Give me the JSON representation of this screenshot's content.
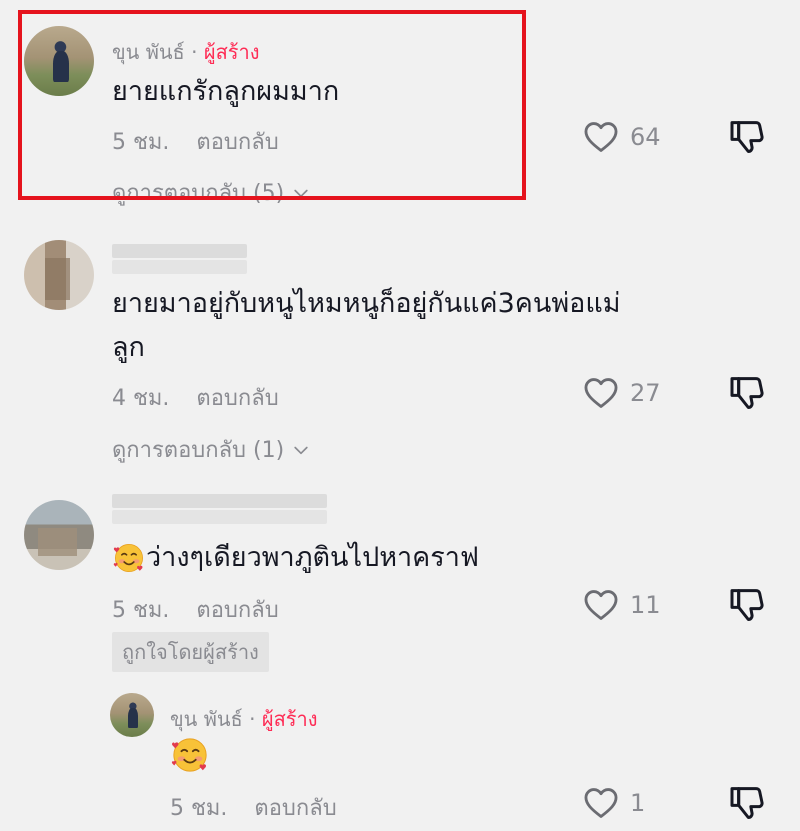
{
  "comments": [
    {
      "author": "ขุน พันธ์",
      "creator_label": "ผู้สร้าง",
      "text": "ยายแกรักลูกผมมาก",
      "time": "5 ชม.",
      "reply": "ตอบกลับ",
      "likes": "64",
      "view_replies": "ดูการตอบกลับ (5)"
    },
    {
      "author": "",
      "text_line1": "ยายมาอยู่กับหนูไหมหนูก็อยู่กันแค่3คนพ่อแม่",
      "text_line2": "ลูก",
      "time": "4 ชม.",
      "reply": "ตอบกลับ",
      "likes": "27",
      "view_replies": "ดูการตอบกลับ (1)"
    },
    {
      "author": "",
      "emoji": "smiling-face-with-hearts",
      "text": "ว่างๆเดียวพาภูตินไปหาคราฟ",
      "time": "5 ชม.",
      "reply": "ตอบกลับ",
      "likes": "11",
      "badge": "ถูกใจโดยผู้สร้าง"
    }
  ],
  "reply": {
    "author": "ขุน พันธ์",
    "creator_label": "ผู้สร้าง",
    "emoji": "smiling-face-with-hearts",
    "time": "5 ชม.",
    "reply": "ตอบกลับ",
    "likes": "1"
  },
  "colors": {
    "background": "#f1f1f1",
    "creator": "#fe2c55",
    "highlight": "#e5131d",
    "muted": "#8a8b91"
  },
  "icons": [
    "heart-outline-icon",
    "thumbs-down-icon",
    "chevron-down-icon"
  ]
}
